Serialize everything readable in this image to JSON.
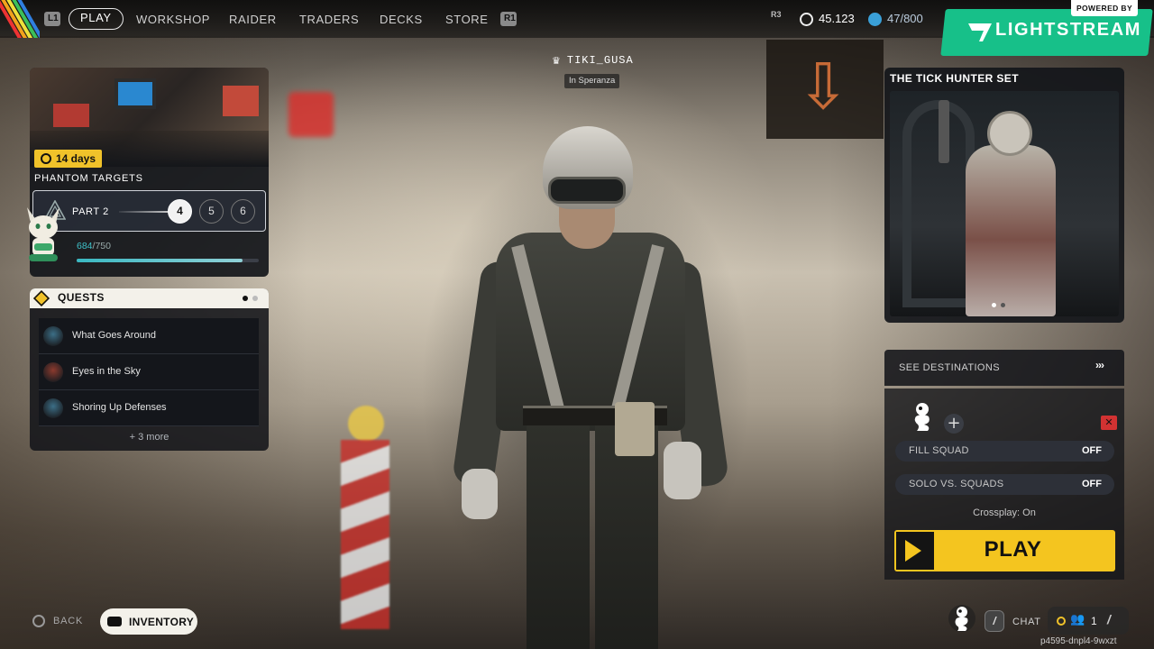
{
  "nav": {
    "left_key": "L1",
    "right_key": "R1",
    "items": [
      "PLAY",
      "WORKSHOP",
      "RAIDER",
      "TRADERS",
      "DECKS",
      "STORE"
    ],
    "active": "PLAY"
  },
  "stats": {
    "r3_hint": "R3",
    "currency": "45.123",
    "capacity": "47/800"
  },
  "branding": {
    "name": "LIGHTSTREAM",
    "powered_by": "POWERED BY",
    "color": "#17c089"
  },
  "player": {
    "username": "TIKI_GUSA",
    "status": "In Speranza"
  },
  "event": {
    "days_left": "14 days",
    "title": "PHANTOM TARGETS",
    "part_label": "PART 2",
    "steps": [
      "4",
      "5",
      "6"
    ],
    "current_step": "4",
    "progress_current": "684",
    "progress_total": "/750",
    "progress_fraction": 0.912
  },
  "quests": {
    "title": "QUESTS",
    "items": [
      {
        "label": "What Goes Around",
        "color": "#3c6f87"
      },
      {
        "label": "Eyes in the Sky",
        "color": "#8c3a2e"
      },
      {
        "label": "Shoring Up Defenses",
        "color": "#3c6f87"
      }
    ],
    "more": "+ 3 more"
  },
  "featured_set": {
    "title": "THE TICK HUNTER SET"
  },
  "destinations": {
    "label": "SEE DESTINATIONS",
    "more_glyph": "›››"
  },
  "squad": {
    "add_glyph": "+",
    "fill_squad_label": "FILL SQUAD",
    "fill_squad_value": "OFF",
    "solo_vs_squads_label": "SOLO VS. SQUADS",
    "solo_vs_squads_value": "OFF",
    "crossplay": "Crossplay: On",
    "play_label": "PLAY"
  },
  "bottom": {
    "back_label": "BACK",
    "inventory_label": "INVENTORY",
    "chat_key": "/",
    "chat_label": "CHAT",
    "party_count": "1",
    "session_id": "p4595-dnpl4-9wxzt"
  },
  "colors": {
    "accent_yellow": "#f4c51f",
    "progress_teal": "#3ec0c8"
  }
}
